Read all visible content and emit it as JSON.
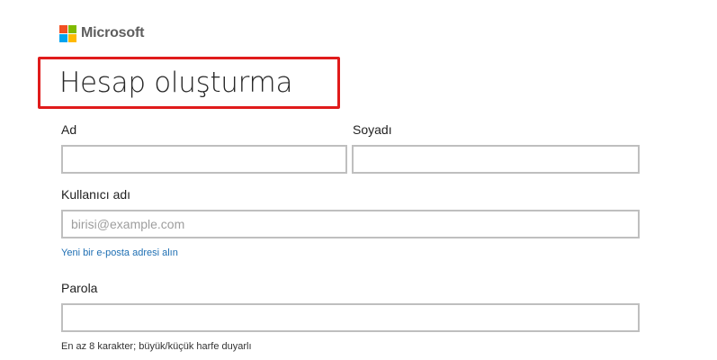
{
  "header": {
    "logo_text": "Microsoft",
    "logo_colors": [
      "#f25022",
      "#7fba00",
      "#00a4ef",
      "#ffb900"
    ]
  },
  "page": {
    "title": "Hesap oluşturma",
    "highlight_color": "#e01b1b"
  },
  "form": {
    "first_name": {
      "label": "Ad",
      "value": ""
    },
    "last_name": {
      "label": "Soyadı",
      "value": ""
    },
    "username": {
      "label": "Kullanıcı adı",
      "placeholder": "birisi@example.com",
      "value": ""
    },
    "new_email_link": "Yeni bir e-posta adresi alın",
    "password": {
      "label": "Parola",
      "value": "",
      "hint": "En az 8 karakter; büyük/küçük harfe duyarlı"
    }
  }
}
